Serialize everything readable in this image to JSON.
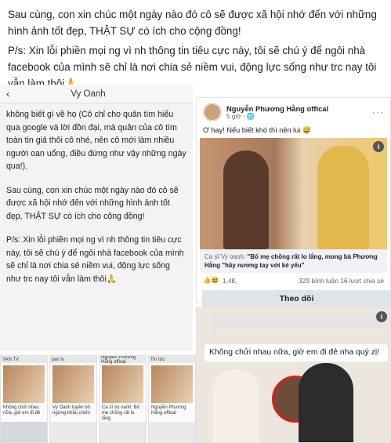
{
  "caption": {
    "line1": "Sau cùng, con xin chúc một ngày nào đó cô sẽ được xã hội nhớ đến với những hình ảnh tốt đẹp, THẬT SỰ có ích cho cộng đồng!",
    "line2": "P/s: Xin lỗi phiền mọi ng vì nh thông tin tiêu cực này, tôi sẽ chú ý để ngôi nhà facebook của mình sẽ chỉ là nơi chia sẻ niềm vui, động lực sống như trc nay tôi vẫn làm thôi🙏"
  },
  "phone": {
    "back_icon": "‹",
    "title": "Vy Oanh",
    "para1": "không biết gì về họ (Cô chỉ cho quân tìm hiểu qua google và lời đồn đại, mà quân của cô tìm toàn tin giả thôi cô nhé, nên cô mới làm nhiều người oan uổng, điều đứng như vậy những ngày qua!).",
    "para2": "Sau cùng, con xin chúc một ngày nào đó cô sẽ được xã hội nhớ đến với những hình ảnh tốt đẹp, THẬT SỰ có ích cho cộng đồng!",
    "para3": "P/s: Xin lỗi phiền mọi ng vì nh thông tin tiêu cực này, tôi sẽ chú ý để ngôi nhà facebook của mình sẽ chỉ là nơi chia sẻ niềm vui, động lực sống như trc nay tôi vẫn làm thôi🙏"
  },
  "fb_post": {
    "author": "Nguyễn Phương Hằng offical",
    "meta": "5 giờ · 🌐",
    "more": "···",
    "status": "Ơ hay! Nếu biết khó thì nên lui 😅",
    "info": "i",
    "link_source": "Ca sĩ Vy oanh:",
    "link_text": "\"Bố mẹ chồng rất lo lắng, mong bà Phương Hằng \"hãy nương tay với kẻ yếu\"",
    "reactions": "1,4K",
    "reaction_icons": "👍😆",
    "counts": "329 bình luận  16 lượt chia sẻ"
  },
  "follow_bar": {
    "label": "Theo dõi"
  },
  "video": {
    "title": "Không chửi nhau nữa, giờ em đi đẻ nha quý zị!",
    "info": "i"
  },
  "minis": [
    {
      "bar": "YAN TV",
      "cap": "Không chửi nhau nữa, giờ em đi đẻ"
    },
    {
      "bar": "yan tv",
      "cap": "Vy Oanh tuyên bố ngừng khẩu chiến"
    },
    {
      "bar": "Nguyễn Phương Hằng offical",
      "cap": "Ca sĩ Vy oanh: Bố mẹ chồng rất lo lắng"
    },
    {
      "bar": "Tin tức",
      "cap": "Nguyễn Phương Hằng offical"
    }
  ]
}
